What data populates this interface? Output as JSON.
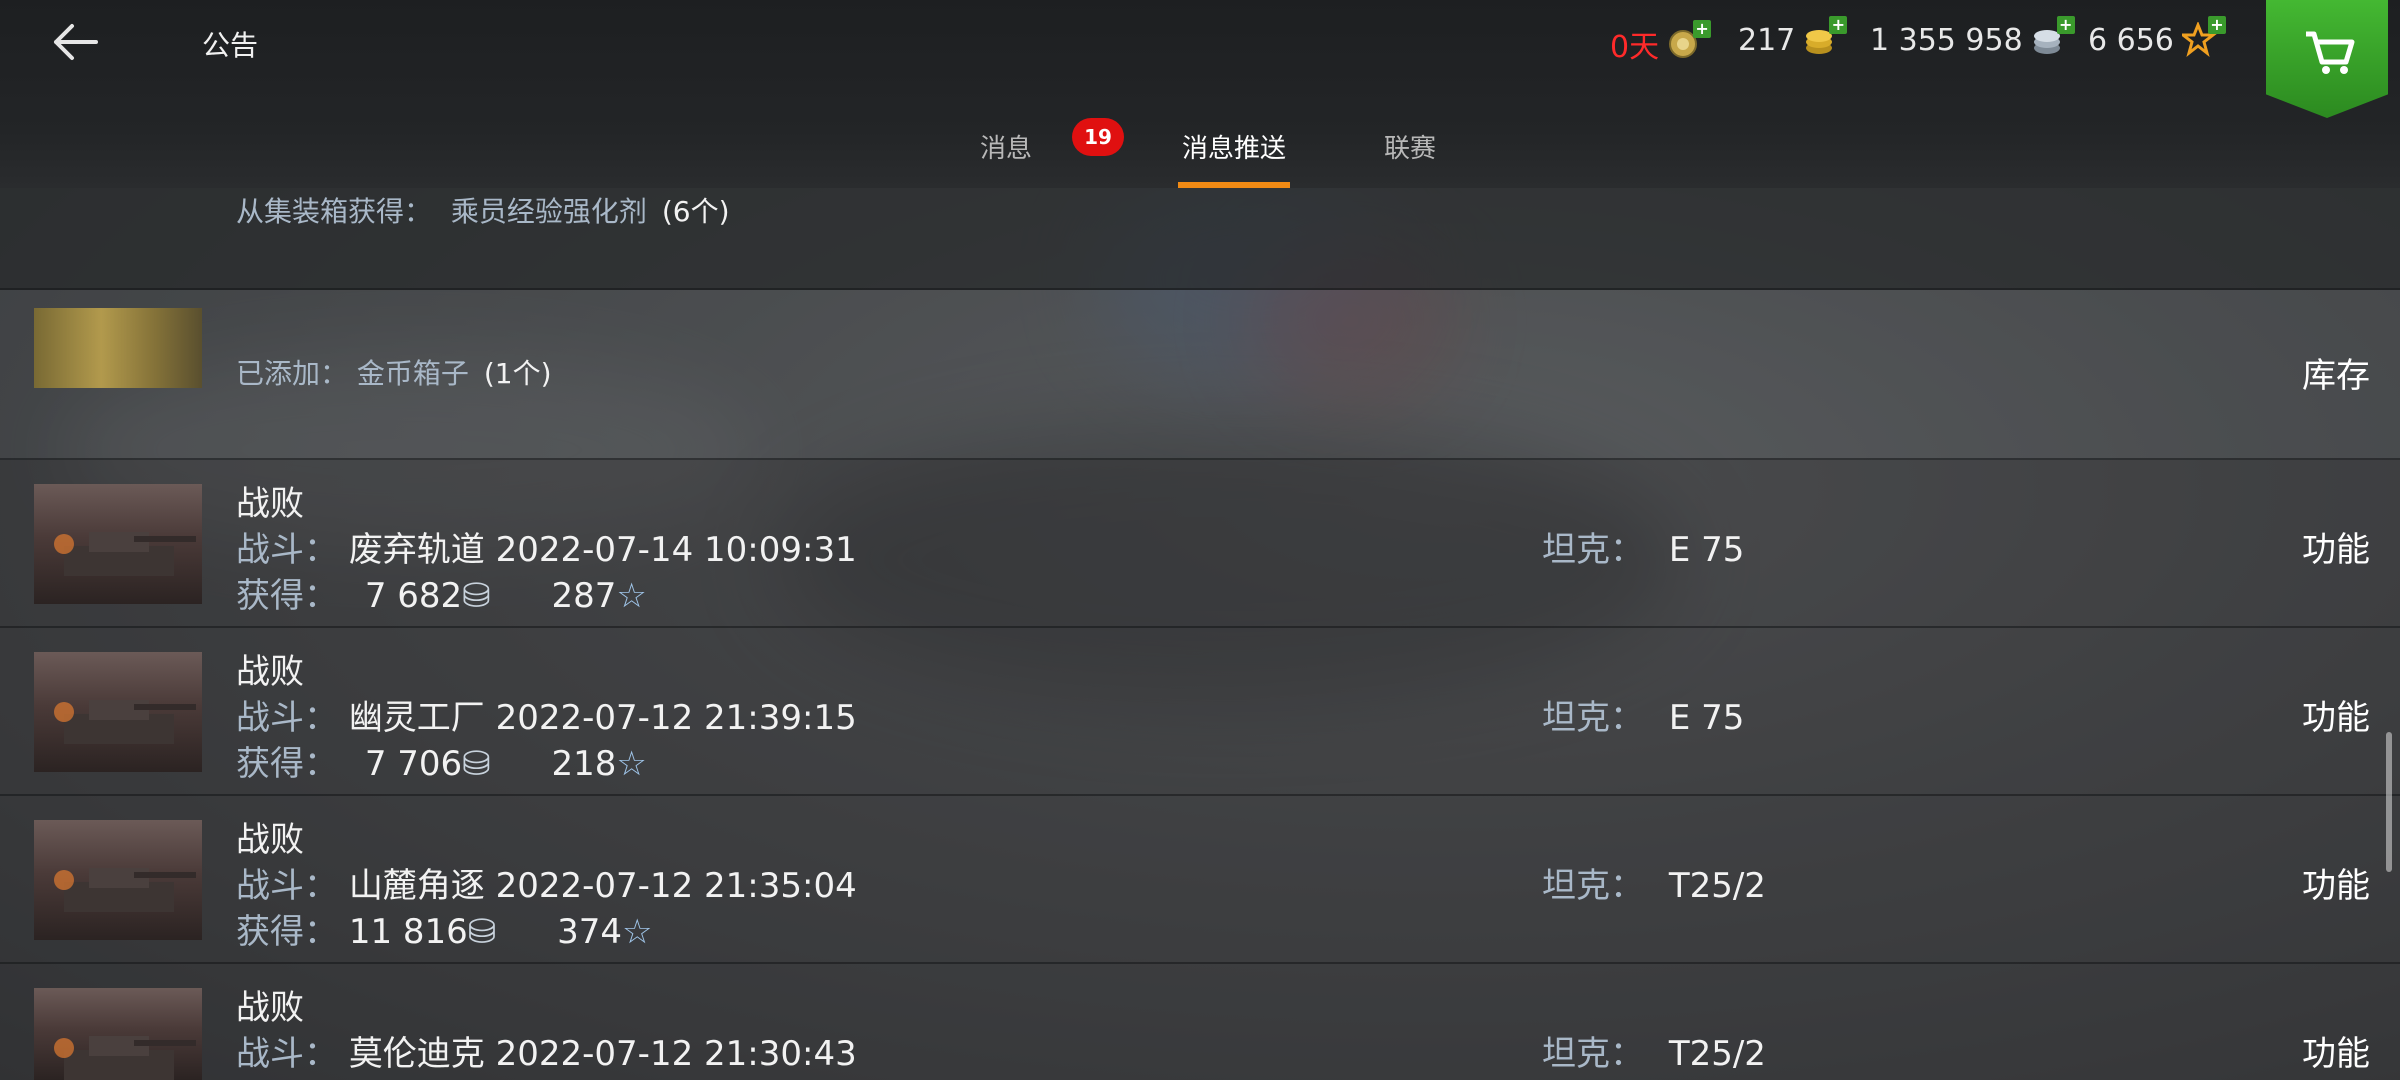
{
  "header": {
    "title": "公告",
    "resources": [
      {
        "value": "0天",
        "icon": "premium-medal-icon",
        "color": "#ff2a2a"
      },
      {
        "value": "217",
        "icon": "gold-coins-icon",
        "color": "#ffffff"
      },
      {
        "value": "1 355 958",
        "icon": "silver-coins-icon",
        "color": "#ffffff"
      },
      {
        "value": "6 656",
        "icon": "free-xp-star-icon",
        "color": "#ffffff"
      }
    ],
    "cart_icon": "shopping-cart-icon"
  },
  "tabs": [
    {
      "label": "消息",
      "badge": "19",
      "active": false
    },
    {
      "label": "消息推送",
      "active": true
    },
    {
      "label": "联赛",
      "active": false
    }
  ],
  "items": [
    {
      "type": "reward",
      "from_label": "从集装箱获得：",
      "item_name": "乘员经验强化剂",
      "count": "(6个)"
    },
    {
      "type": "added",
      "added_label": "已添加：",
      "item_name": "金币箱子",
      "count": "(1个)",
      "action": "库存"
    },
    {
      "type": "battle",
      "result": "战败",
      "battle_label": "战斗：",
      "map_time": "废弃轨道 2022-07-14 10:09:31",
      "earned_label": "获得：",
      "credits": "7 682",
      "xp": "287",
      "tank_label": "坦克：",
      "tank": "E 75",
      "action": "功能"
    },
    {
      "type": "battle",
      "result": "战败",
      "battle_label": "战斗：",
      "map_time": "幽灵工厂 2022-07-12 21:39:15",
      "earned_label": "获得：",
      "credits": "7 706",
      "xp": "218",
      "tank_label": "坦克：",
      "tank": "E 75",
      "action": "功能"
    },
    {
      "type": "battle",
      "result": "战败",
      "battle_label": "战斗：",
      "map_time": "山麓角逐 2022-07-12 21:35:04",
      "earned_label": "获得：",
      "credits": "11 816",
      "xp": "374",
      "tank_label": "坦克：",
      "tank": "T25/2",
      "action": "功能"
    },
    {
      "type": "battle",
      "result": "战败",
      "battle_label": "战斗：",
      "map_time": "莫伦迪克 2022-07-12 21:30:43",
      "tank_label": "坦克：",
      "tank": "T25/2",
      "action": "功能"
    }
  ],
  "colors": {
    "accent": "#f08a14",
    "badge": "#e01010",
    "label": "#a9b8c8",
    "cart": "#3aa82a"
  }
}
